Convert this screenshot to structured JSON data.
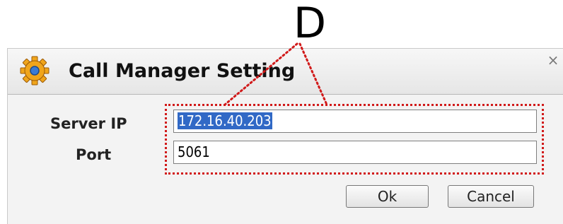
{
  "annotation": {
    "letter": "D"
  },
  "dialog": {
    "title": "Call Manager Setting",
    "title_icon": "gear-icon",
    "close_label": "×"
  },
  "form": {
    "server_ip": {
      "label": "Server IP",
      "value": "172.16.40.203",
      "selected": true
    },
    "port": {
      "label": "Port",
      "value": "5061"
    }
  },
  "buttons": {
    "ok": "Ok",
    "cancel": "Cancel"
  },
  "colors": {
    "highlight": "#d11a1a",
    "selection": "#3169c6",
    "gear": "#f0a51b"
  }
}
